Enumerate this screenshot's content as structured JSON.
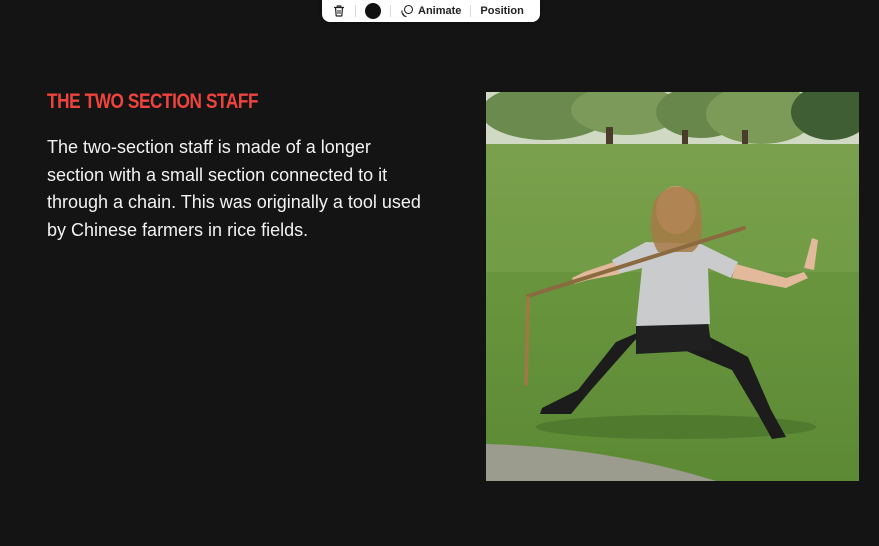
{
  "toolbar": {
    "delete_icon": "trash-icon",
    "color_value": "#111111",
    "animate_label": "Animate",
    "animate_icon": "animate-icon",
    "position_label": "Position"
  },
  "slide": {
    "heading": "THE TWO SECTION STAFF",
    "heading_color": "#f0433d",
    "body": "The two-section staff is made of a longer section with a small section connected to it through a chain. This was originally a tool used by Chinese farmers in rice fields.",
    "background": "#141414"
  }
}
